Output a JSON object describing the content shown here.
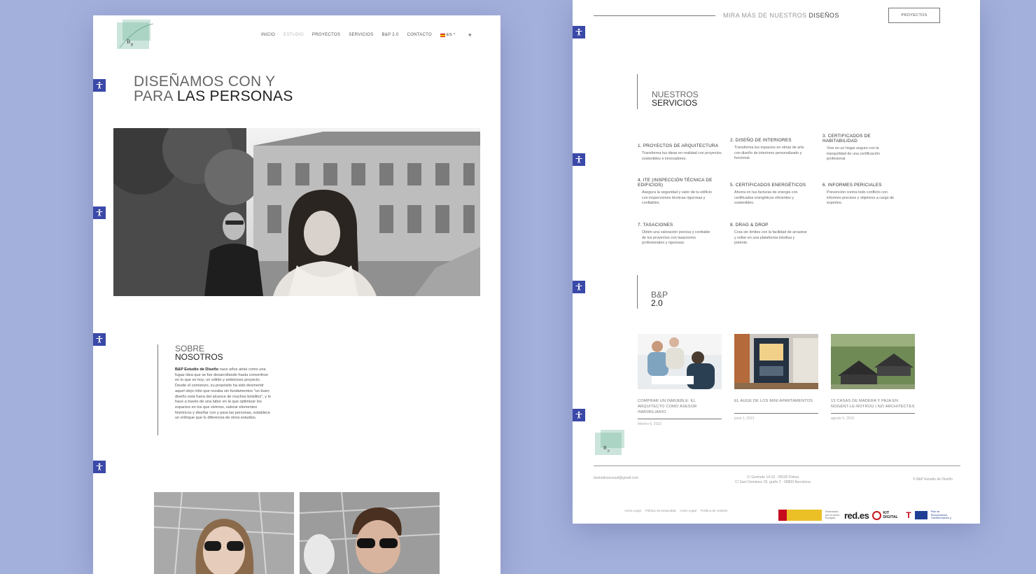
{
  "colors": {
    "background": "#a4b0dc",
    "accessibility": "#3a48a8",
    "rule": "#555555"
  },
  "left": {
    "nav": {
      "items": [
        "INICIO",
        "ESTUDIO",
        "PROYECTOS",
        "SERVICIOS",
        "B&P 2.0",
        "CONTACTO"
      ],
      "active": "ESTUDIO",
      "lang": "ES ^",
      "plus": "+"
    },
    "hero": {
      "line1": "DISEÑAMOS CON Y",
      "line2_thin": "PARA ",
      "line2_bold": "LAS PERSONAS"
    },
    "about": {
      "title_thin": "SOBRE",
      "title_bold": "NOSOTROS",
      "lead": "B&P Estudio de Diseño",
      "body": " nace años atrás como una fugaz idea que se fue desarrollando hasta convertirse en lo que es hoy; un sólido y ambicioso proyecto. Desde el comienzo, su propósito ha sido desmentir aquel viejo mito que rezaba sin fundamentos \"un buen diseño está fuera del alcance de muchos bolsillos\", y lo hace a través de una labor en la que optimizar los espacios en los que vivimos, valorar elementos históricos y diseñar con y para las personas, establece un enfoque que lo diferencia de otros estudios."
    }
  },
  "right": {
    "top": {
      "text_thin": "MIRA MÁS DE NUESTROS ",
      "text_bold": "DISEÑOS",
      "button": "PROYECTOS"
    },
    "services": {
      "title_thin": "NUESTROS",
      "title_bold": "SERVICIOS",
      "items": [
        {
          "title": "1. PROYECTOS DE ARQUITECTURA",
          "desc": "Transforma tus ideas en realidad con proyectos sostenibles e innovadores."
        },
        {
          "title": "2. DISEÑO DE INTERIORES",
          "desc": "Transforma tus espacios en obras de arte con diseño de interiores personalizado y funcional."
        },
        {
          "title": "3. CERTIFICADOS DE HABITABILIDAD",
          "desc": "Vive en un hogar seguro con la tranquilidad de una certificación profesional."
        },
        {
          "title": "4. ITE (INSPECCIÓN TÉCNICA DE EDIFICIOS)",
          "desc": "Asegura la seguridad y valor de tu edificio con inspecciones técnicas rigurosas y confiables."
        },
        {
          "title": "5. CERTIFICADOS ENERGÉTICOS",
          "desc": "Ahorra en tus facturas de energía con certificados energéticos eficientes y sostenibles."
        },
        {
          "title": "6. INFORMES PERICIALES",
          "desc": "Prevención contra todo conflicto con informes precisos y objetivos a cargo de expertos."
        },
        {
          "title": "7. TASACIONES",
          "desc": "Obtén una valoración precisa y confiable de tus proyectos con tasaciones profesionales y rigurosas."
        },
        {
          "title": "8. DRAG & DROP",
          "desc": "Crea sin límites con la facilidad de arrastrar y soltar en una plataforma intuitiva y potente."
        }
      ]
    },
    "bp20": {
      "title_thin": "B&P",
      "title_bold": "2.0",
      "posts": [
        {
          "title": "COMPRAR UN INMUEBLE: EL ARQUITECTO COMO ASESOR INMOBILIARIO",
          "date": "febrero 6, 2023"
        },
        {
          "title": "EL AUGE DE LOS MINI APARTAMENTOS",
          "date": "junio 1, 2021"
        },
        {
          "title": "13 CASAS DE MADERA Y PAJA EN NOGENT-LE-ROTROU | NZI ARCHITECTES",
          "date": "agosto 5, 2019"
        }
      ]
    },
    "footer": {
      "email": "bestudiosensual@gmail.com",
      "addr1": "C/ Gertrude 14-16 · 08192 Palma",
      "addr2": "C/ Sant Domènec 35, grafic 2 · 08800 Barcelona",
      "copy": "© B&P Estudio de Diseño",
      "links": [
        "Aviso Legal",
        "Política de privacidad",
        "Aviso Legal",
        "Política de cookies"
      ],
      "funding": [
        "Financiado por la Unión Europea",
        "red.es",
        "KIT DIGITAL",
        "Plan de Recuperación, Transformación y Resiliencia"
      ]
    }
  }
}
